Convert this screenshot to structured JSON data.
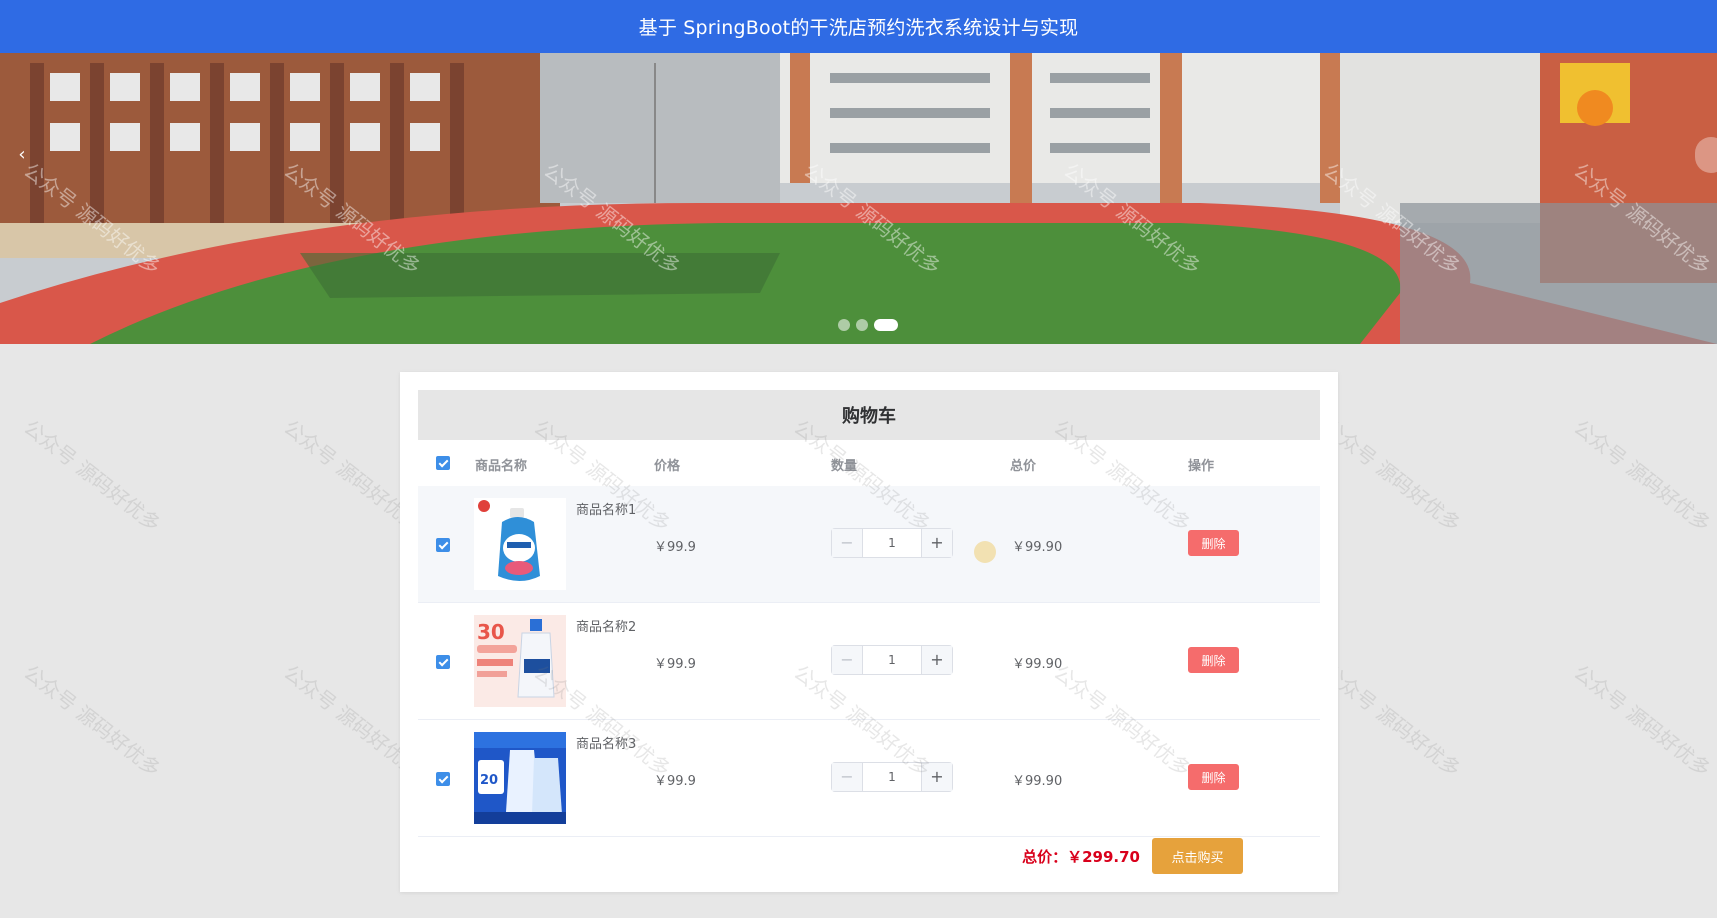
{
  "header": {
    "title": "基于 SpringBoot的干洗店预约洗衣系统设计与实现"
  },
  "carousel": {
    "prev_label": "‹",
    "slide_count": 3,
    "active_slide": 3
  },
  "cart": {
    "title": "购物车",
    "columns": {
      "name": "商品名称",
      "price": "价格",
      "quantity": "数量",
      "subtotal": "总价",
      "action": "操作"
    },
    "items": [
      {
        "name": "商品名称1",
        "price": "￥99.9",
        "quantity": "1",
        "subtotal": "￥99.90",
        "delete_label": "删除",
        "checked": true,
        "thumb_icon": "detergent-bottle-image"
      },
      {
        "name": "商品名称2",
        "price": "￥99.9",
        "quantity": "1",
        "subtotal": "￥99.90",
        "delete_label": "删除",
        "checked": true,
        "thumb_icon": "laundry-promo-image"
      },
      {
        "name": "商品名称3",
        "price": "￥99.9",
        "quantity": "1",
        "subtotal": "￥99.90",
        "delete_label": "删除",
        "checked": true,
        "thumb_icon": "detergent-set-image"
      }
    ],
    "total_label": "总价：￥299.70",
    "buy_label": "点击购买"
  },
  "watermark": {
    "text": "公众号 源码好优多"
  },
  "colors": {
    "header_bg": "#2f6be4",
    "delete_btn": "#f56c6c",
    "buy_btn": "#e6a23c",
    "total_text": "#d9001b",
    "checkbox": "#3d8ee8"
  }
}
